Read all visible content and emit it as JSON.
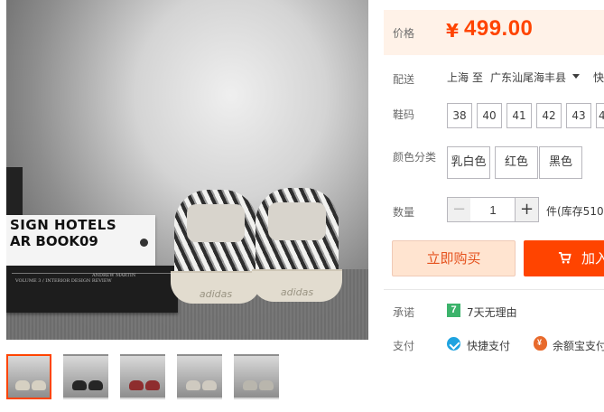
{
  "gallery": {
    "book_white_line1": "SIGN HOTELS",
    "book_white_line2": "AR BOOK09",
    "book_dark_spine_left": "VOLUME 3 / INTERIOR DESIGN REVIEW",
    "book_dark_spine_right": "ANDREW MARTIN",
    "shoe_logo": "adidas",
    "thumbnails": [
      {
        "active": true,
        "shoe_color": "#d6d0c2"
      },
      {
        "active": false,
        "shoe_color": "#262626"
      },
      {
        "active": false,
        "shoe_color": "#8e2d2e"
      },
      {
        "active": false,
        "shoe_color": "#cfcac0"
      },
      {
        "active": false,
        "shoe_color": "#b9b6ad"
      }
    ]
  },
  "price": {
    "label": "价格",
    "currency": "¥",
    "value": "499.00",
    "color": "#ff4400"
  },
  "delivery": {
    "label": "配送",
    "from": "上海",
    "to_word": "至",
    "destination": "广东汕尾海丰县",
    "express": "快"
  },
  "sizes": {
    "label": "鞋码",
    "options": [
      "38",
      "40",
      "41",
      "42",
      "43",
      "4"
    ]
  },
  "colors": {
    "label": "颜色分类",
    "options": [
      "乳白色",
      "红色",
      "黑色"
    ]
  },
  "quantity": {
    "label": "数量",
    "minus": "−",
    "value": "1",
    "plus": "+",
    "stock": "件(库存510"
  },
  "actions": {
    "buy_now": "立即购买",
    "add_to_cart": "加入"
  },
  "promise": {
    "label": "承诺",
    "icon_text": "7",
    "text": "7天无理由"
  },
  "payment": {
    "label": "支付",
    "methods": [
      "快捷支付",
      "余额宝支付"
    ]
  }
}
